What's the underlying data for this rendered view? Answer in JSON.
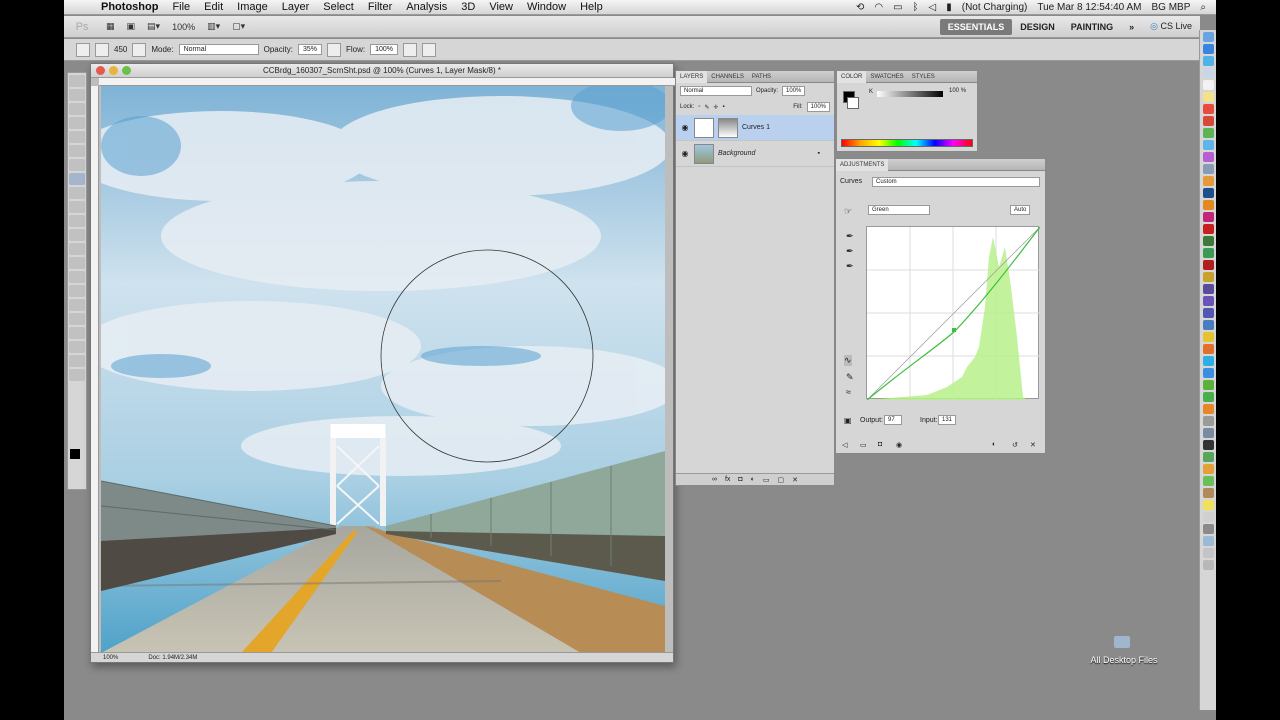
{
  "menubar": {
    "app": "Photoshop",
    "items": [
      "File",
      "Edit",
      "Image",
      "Layer",
      "Select",
      "Filter",
      "Analysis",
      "3D",
      "View",
      "Window",
      "Help"
    ],
    "battery": "(Not Charging)",
    "clock": "Tue Mar 8  12:54:40 AM",
    "user": "BG MBP"
  },
  "appbar": {
    "logo": "Ps",
    "zoom": "100%",
    "workspaces": [
      "ESSENTIALS",
      "DESIGN",
      "PAINTING"
    ],
    "more": "»",
    "cs_live": "CS Live"
  },
  "options": {
    "mode_label": "Mode:",
    "mode_value": "Normal",
    "opacity_label": "Opacity:",
    "opacity_value": "35%",
    "flow_label": "Flow:",
    "flow_value": "100%",
    "brush_size": "450"
  },
  "document": {
    "title": "CCBrdg_160307_ScrnSht.psd @ 100% (Curves 1, Layer Mask/8) *",
    "zoom": "100%",
    "doc_info": "Doc: 1.94M/2.34M"
  },
  "layers": {
    "tabs": [
      "LAYERS",
      "CHANNELS",
      "PATHS"
    ],
    "blend": "Normal",
    "opacity_label": "Opacity:",
    "opacity": "100%",
    "lock_label": "Lock:",
    "fill_label": "Fill:",
    "fill": "100%",
    "items": [
      {
        "name": "Curves 1",
        "active": true
      },
      {
        "name": "Background",
        "active": false
      }
    ]
  },
  "color": {
    "tabs": [
      "COLOR",
      "SWATCHES",
      "STYLES"
    ],
    "channel": "K",
    "value": "100",
    "unit": "%"
  },
  "adjustments": {
    "tab": "ADJUSTMENTS",
    "type_label": "Curves",
    "preset": "Custom",
    "channel": "Green",
    "auto": "Auto",
    "output_label": "Output:",
    "output": "97",
    "input_label": "Input:",
    "input": "131"
  },
  "desktop": {
    "folder_label": "All Desktop Files"
  },
  "colors": {
    "selected_layer": "#b9d0ee",
    "histogram": "#b7f08a",
    "curve": "#3cbf3c"
  }
}
